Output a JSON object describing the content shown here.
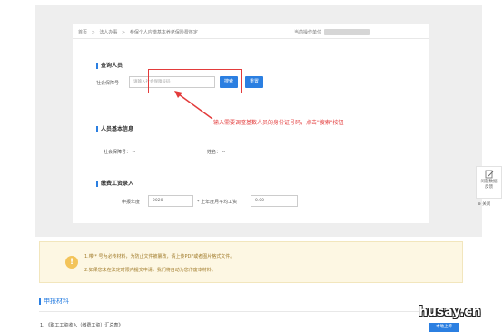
{
  "breadcrumb": {
    "home": "首页",
    "sep": ">",
    "section": "法人办事",
    "page": "参保个人应缴基本养老保险费核定"
  },
  "operator_label": "当前操作单位",
  "query_section": {
    "title": "查询人员",
    "ssn_label": "社会保障号",
    "ssn_placeholder": "请输入社会保障号码",
    "search_label": "搜索",
    "reset_label": "重置"
  },
  "annotation": "输入需要调整基数人员的身份证号码，点击\"搜索\"按钮",
  "basic_info": {
    "title": "人员基本信息",
    "ssn_label": "社会保障号：",
    "ssn_value": "--",
    "name_label": "姓名：",
    "name_value": "--"
  },
  "wage_section": {
    "title": "缴费工资录入",
    "year_label": "申报年度",
    "year_value": "2020",
    "wage_label": "* 上年度月平均工资",
    "wage_value": "0.00"
  },
  "side_widget": {
    "line1": "问题数据",
    "line2": "反馈",
    "close": "关闭"
  },
  "notice": {
    "icon": "!",
    "line1": "1.带 * 号为必传材料，为防止文件被篡改，请上传PDF或者图片格式文件。",
    "line2": "2.如果您未在法定时限内提交申请，我们将自动为您作废本材料。"
  },
  "materials": {
    "title": "申报材料",
    "item1": "1.  《职工工资收入（缴费工资）汇总表》",
    "upload_label": "本地上传"
  },
  "watermark": "husay.cn",
  "colors": {
    "accent": "#2b7fe1",
    "annotation": "#e33b3b",
    "notice_bg": "#fdf7e3"
  }
}
